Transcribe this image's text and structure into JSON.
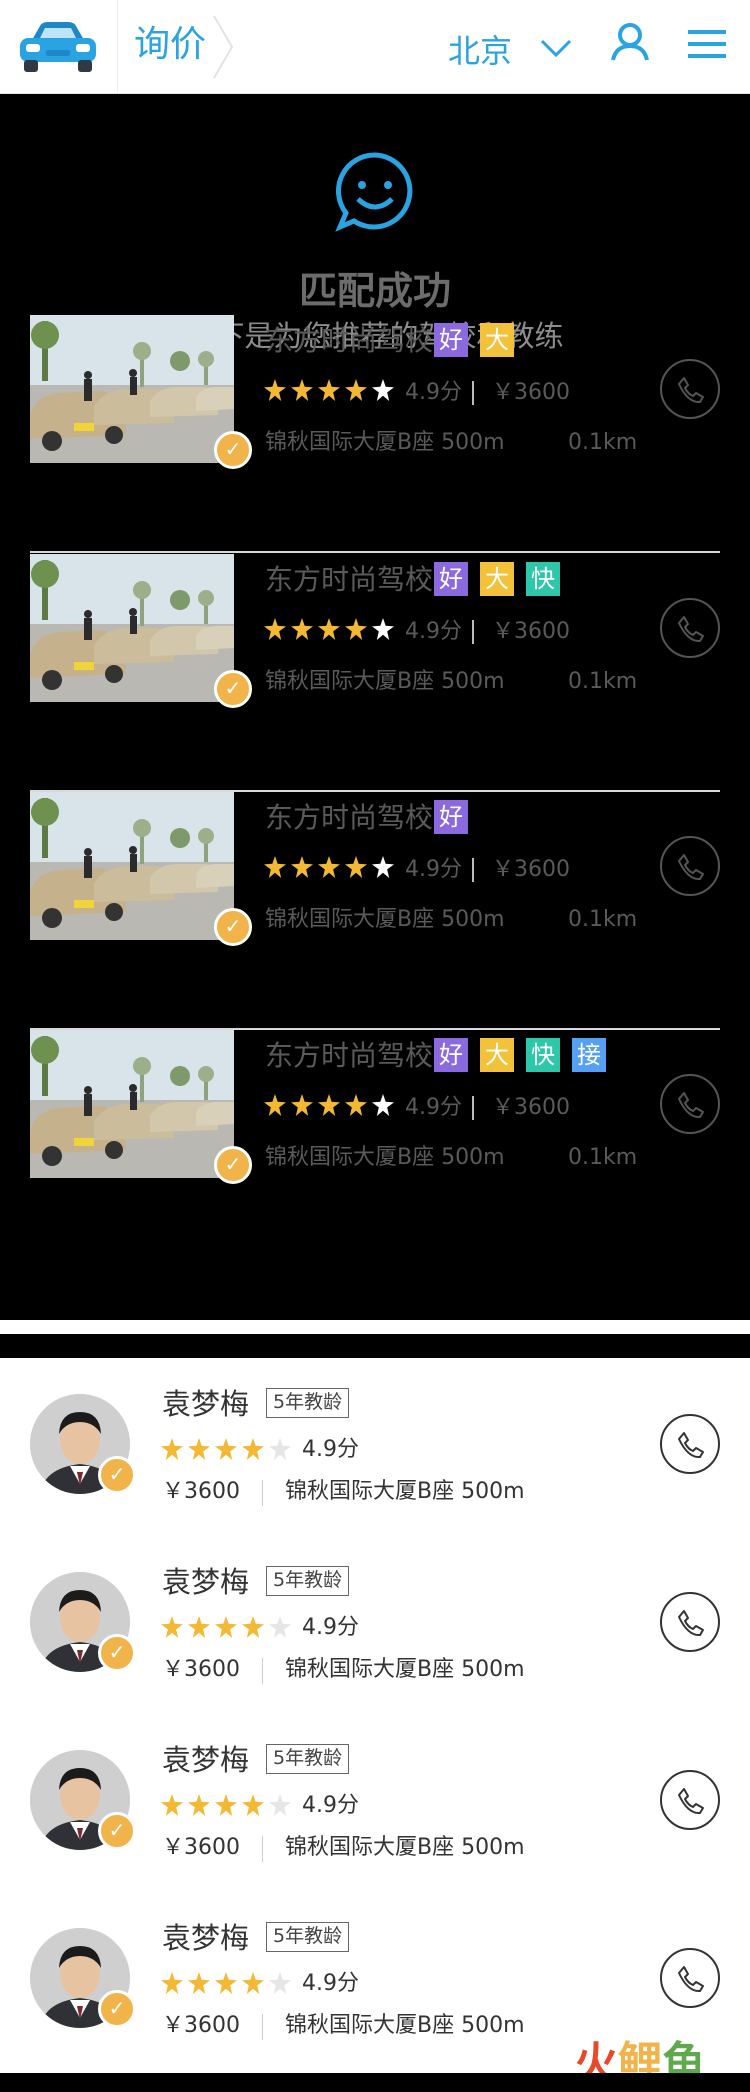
{
  "header": {
    "title": "询价",
    "city": "北京"
  },
  "match": {
    "title": "匹配成功",
    "subtitle": "以下是为您推荐的驾校和教练"
  },
  "schools": [
    {
      "name": "东方时尚驾校",
      "tags": [
        "好",
        "大"
      ],
      "stars": 4,
      "rating": "4.9分",
      "price": "￥3600",
      "address": "锦秋国际大厦B座 500m",
      "distance": "0.1km"
    },
    {
      "name": "东方时尚驾校",
      "tags": [
        "好",
        "大",
        "快"
      ],
      "stars": 4,
      "rating": "4.9分",
      "price": "￥3600",
      "address": "锦秋国际大厦B座 500m",
      "distance": "0.1km"
    },
    {
      "name": "东方时尚驾校",
      "tags": [
        "好"
      ],
      "stars": 4,
      "rating": "4.9分",
      "price": "￥3600",
      "address": "锦秋国际大厦B座 500m",
      "distance": "0.1km"
    },
    {
      "name": "东方时尚驾校",
      "tags": [
        "好",
        "大",
        "快",
        "接"
      ],
      "stars": 4,
      "rating": "4.9分",
      "price": "￥3600",
      "address": "锦秋国际大厦B座 500m",
      "distance": "0.1km"
    }
  ],
  "coaches": [
    {
      "name": "袁梦梅",
      "experience": "5年教龄",
      "stars": 4,
      "rating": "4.9分",
      "price": "￥3600",
      "address": "锦秋国际大厦B座 500m"
    },
    {
      "name": "袁梦梅",
      "experience": "5年教龄",
      "stars": 4,
      "rating": "4.9分",
      "price": "￥3600",
      "address": "锦秋国际大厦B座 500m"
    },
    {
      "name": "袁梦梅",
      "experience": "5年教龄",
      "stars": 4,
      "rating": "4.9分",
      "price": "￥3600",
      "address": "锦秋国际大厦B座 500m"
    },
    {
      "name": "袁梦梅",
      "experience": "5年教龄",
      "stars": 4,
      "rating": "4.9分",
      "price": "￥3600",
      "address": "锦秋国际大厦B座 500m"
    }
  ],
  "badge_mark": "✓",
  "watermark": {
    "c1": "火",
    "c2": "鲤",
    "c3": "鱼"
  },
  "colors": {
    "accent": "#2aa3e3",
    "star": "#f3b934",
    "badge": "#f0b44a",
    "tag_hao": "#8b6ae0",
    "tag_da": "#f3c23a",
    "tag_kuai": "#2ec7a9",
    "tag_jie": "#56a0f4"
  },
  "icons": [
    "car-logo-icon",
    "chevron-right-icon",
    "chevron-down-icon",
    "user-icon",
    "menu-icon",
    "smiley-icon",
    "star-icon",
    "phone-icon",
    "verified-badge-icon"
  ]
}
